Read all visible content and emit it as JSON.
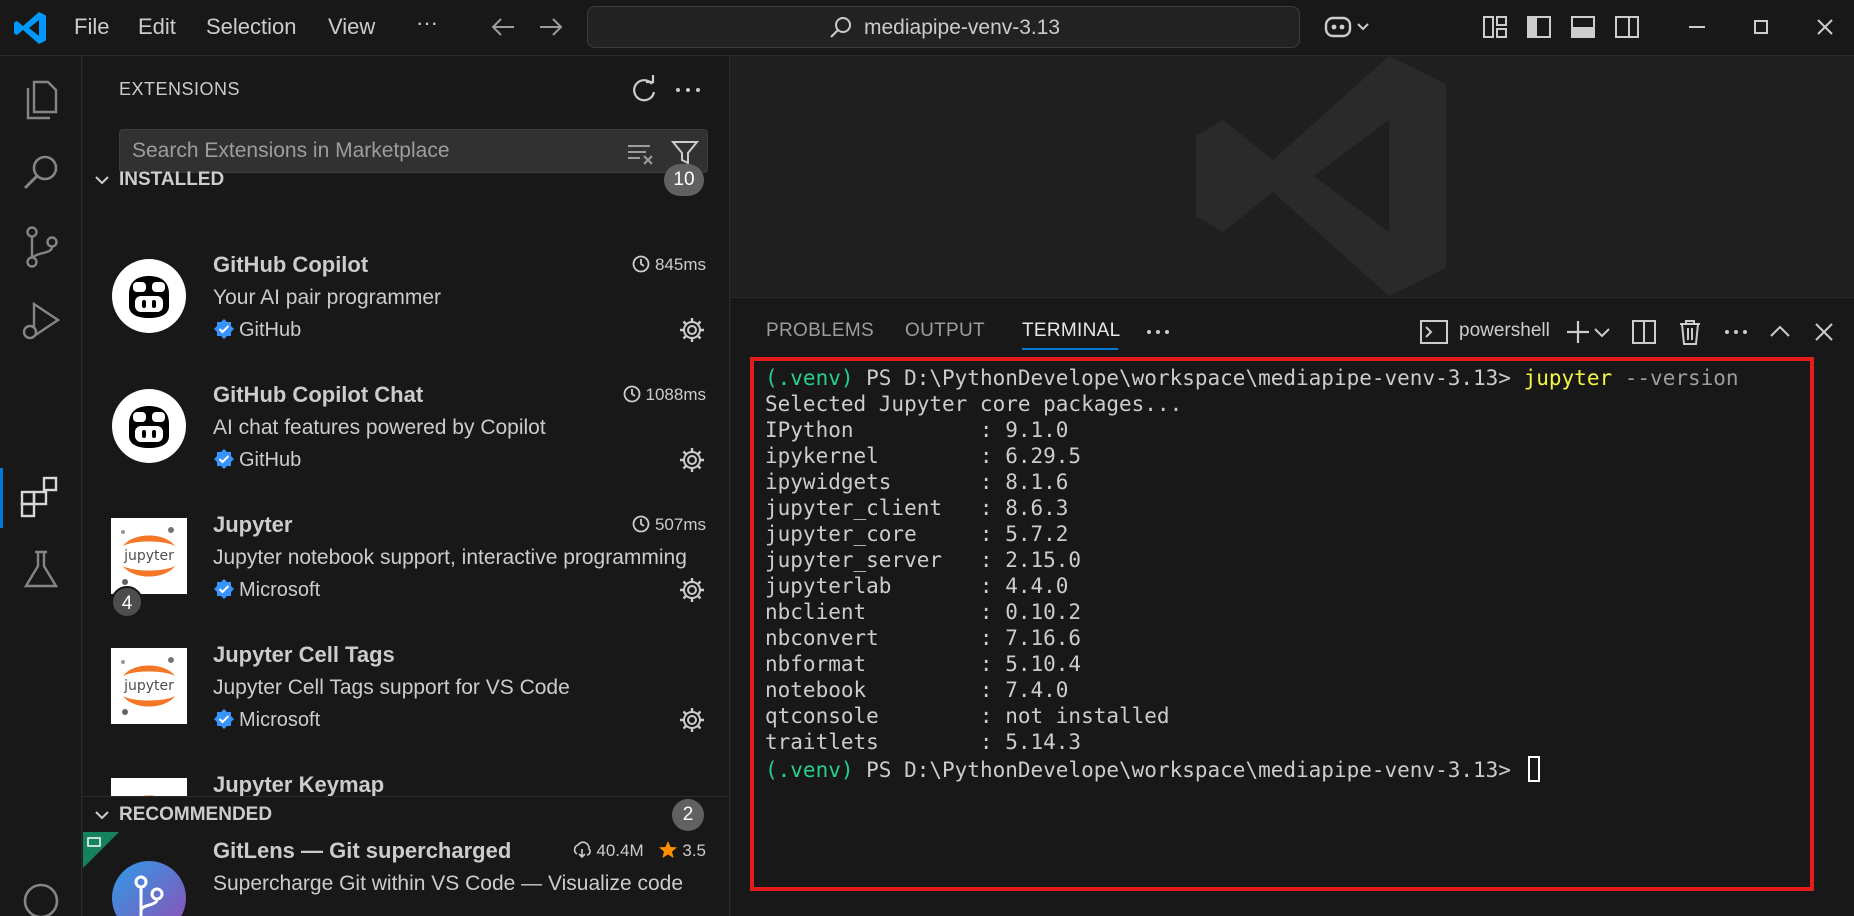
{
  "titlebar": {
    "menu": [
      "File",
      "Edit",
      "Selection",
      "View",
      "···"
    ],
    "command_center": "mediapipe-venv-3.13"
  },
  "sidebar": {
    "title": "EXTENSIONS",
    "search_placeholder": "Search Extensions in Marketplace",
    "installed": {
      "label": "INSTALLED",
      "count": "10",
      "items": [
        {
          "name": "GitHub Copilot",
          "desc": "Your AI pair programmer",
          "publisher": "GitHub",
          "time": "845ms",
          "icon": "copilot-icon"
        },
        {
          "name": "GitHub Copilot Chat",
          "desc": "AI chat features powered by Copilot",
          "publisher": "GitHub",
          "time": "1088ms",
          "icon": "copilot-icon"
        },
        {
          "name": "Jupyter",
          "desc": "Jupyter notebook support, interactive programming",
          "publisher": "Microsoft",
          "time": "507ms",
          "icon": "jupyter-icon",
          "badge": "4"
        },
        {
          "name": "Jupyter Cell Tags",
          "desc": "Jupyter Cell Tags support for VS Code",
          "publisher": "Microsoft",
          "icon": "jupyter-icon"
        },
        {
          "name": "Jupyter Keymap",
          "icon": "jupyter-icon"
        }
      ]
    },
    "recommended": {
      "label": "RECOMMENDED",
      "count": "2",
      "items": [
        {
          "name": "GitLens — Git supercharged",
          "desc": "Supercharge Git within VS Code — Visualize code",
          "downloads": "40.4M",
          "rating": "3.5",
          "icon": "gitlens-icon"
        }
      ]
    }
  },
  "panel": {
    "tabs": [
      "PROBLEMS",
      "OUTPUT",
      "TERMINAL"
    ],
    "active_tab": "TERMINAL",
    "shell": "powershell"
  },
  "terminal": {
    "venv": "(.venv)",
    "prompt": " PS D:\\PythonDevelope\\workspace\\mediapipe-venv-3.13> ",
    "command": "jupyter",
    "args": " --version",
    "header": "Selected Jupyter core packages...",
    "packages": [
      "IPython          : 9.1.0",
      "ipykernel        : 6.29.5",
      "ipywidgets       : 8.1.6",
      "jupyter_client   : 8.6.3",
      "jupyter_core     : 5.7.2",
      "jupyter_server   : 2.15.0",
      "jupyterlab       : 4.4.0",
      "nbclient         : 0.10.2",
      "nbconvert        : 7.16.6",
      "nbformat         : 5.10.4",
      "notebook         : 7.4.0",
      "qtconsole        : not installed",
      "traitlets        : 5.14.3"
    ]
  },
  "colors": {
    "accent": "#0078d4",
    "highlight_box": "#e51c1c",
    "venv_green": "#23d18b",
    "command_yellow": "#f5f543"
  }
}
